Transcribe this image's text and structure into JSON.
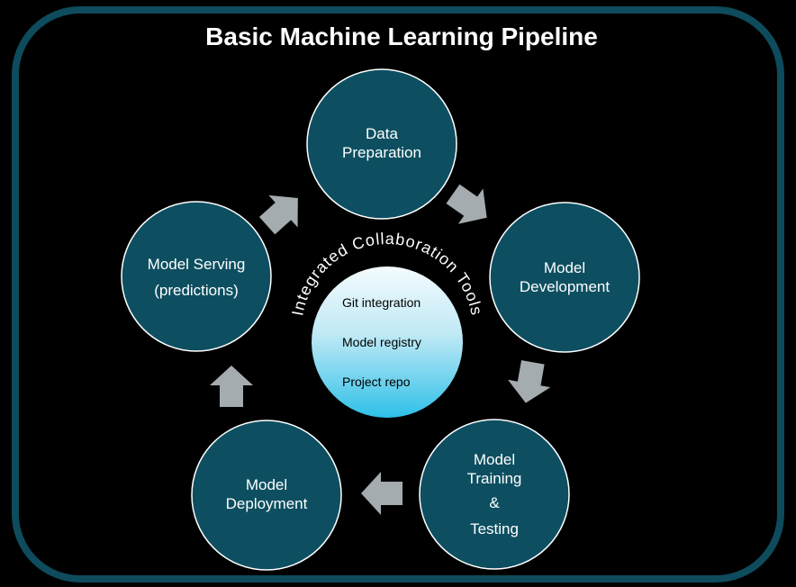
{
  "title": "Basic Machine Learning Pipeline",
  "colors": {
    "background": "#000000",
    "frame_border": "#0e4b5c",
    "stage_fill": "#0d4f61",
    "stage_stroke": "#ffffff",
    "arrow": "#a4acb0",
    "hub_top": "#f4fbfd",
    "hub_bottom": "#2fc0e8",
    "text_light": "#ffffff",
    "text_dark": "#000000"
  },
  "stages": [
    {
      "id": "data-preparation",
      "lines": [
        "Data",
        "Preparation"
      ]
    },
    {
      "id": "model-development",
      "lines": [
        "Model",
        "Development"
      ]
    },
    {
      "id": "model-training-testing",
      "lines": [
        "Model",
        "Training",
        "&",
        "Testing"
      ]
    },
    {
      "id": "model-deployment",
      "lines": [
        "Model",
        "Deployment"
      ]
    },
    {
      "id": "model-serving",
      "lines": [
        "Model Serving",
        "(predictions)"
      ]
    }
  ],
  "hub": {
    "arc_label": "Integrated Collaboration Tools",
    "items": [
      "Git integration",
      "Model registry",
      "Project repo"
    ]
  },
  "flow_arrows": [
    {
      "from": "data-preparation",
      "to": "model-development",
      "icon": "chevron-arrow-icon"
    },
    {
      "from": "model-development",
      "to": "model-training-testing",
      "icon": "chevron-arrow-icon"
    },
    {
      "from": "model-training-testing",
      "to": "model-deployment",
      "icon": "chevron-arrow-icon"
    },
    {
      "from": "model-deployment",
      "to": "model-serving",
      "icon": "chevron-arrow-icon"
    },
    {
      "from": "model-serving",
      "to": "data-preparation",
      "icon": "chevron-arrow-icon"
    }
  ]
}
